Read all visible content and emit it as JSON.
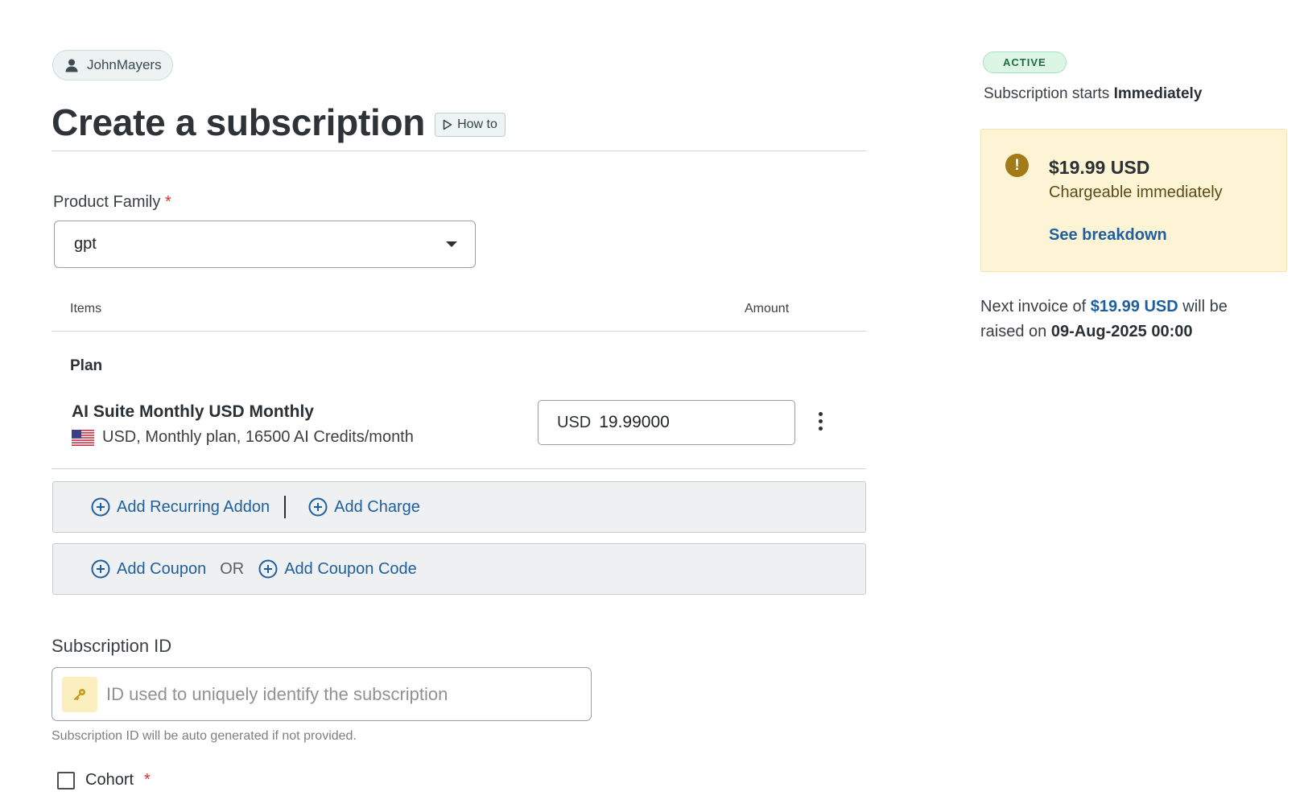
{
  "user": {
    "name": "JohnMayers"
  },
  "page": {
    "title": "Create a subscription",
    "how_to_label": "How to"
  },
  "product_family": {
    "label": "Product Family",
    "required_mark": "*",
    "value": "gpt"
  },
  "items_table": {
    "col_items": "Items",
    "col_amount": "Amount",
    "section_label": "Plan",
    "plan": {
      "name": "AI Suite Monthly USD Monthly",
      "details": "USD, Monthly plan, 16500 AI Credits/month",
      "currency": "USD",
      "amount": "19.99000"
    }
  },
  "actions": {
    "add_recurring_addon": "Add Recurring Addon",
    "add_charge": "Add Charge",
    "add_coupon": "Add Coupon",
    "or_text": "OR",
    "add_coupon_code": "Add Coupon Code"
  },
  "subscription_id": {
    "label": "Subscription ID",
    "placeholder": "ID used to uniquely identify the subscription",
    "value": "",
    "hint": "Subscription ID will be auto generated if not provided."
  },
  "cohort": {
    "label": "Cohort",
    "required_mark": "*",
    "checked": false
  },
  "summary": {
    "status": "ACTIVE",
    "starts_prefix": "Subscription starts",
    "starts_value": "Immediately",
    "charge_amount": "$19.99 USD",
    "charge_note": "Chargeable immediately",
    "breakdown_link": "See breakdown",
    "next_invoice_prefix": "Next invoice of",
    "next_invoice_amount": "$19.99 USD",
    "next_invoice_middle": "will be raised on",
    "next_invoice_date": "09-Aug-2025 00:00"
  },
  "colors": {
    "link": "#1f5f9e",
    "warning_bg": "#fdf4d6",
    "active_badge": "#dcf5e4",
    "required": "#d0312d"
  },
  "icons": [
    "user-icon",
    "play-icon",
    "chevron-down-icon",
    "us-flag-icon",
    "kebab-menu-icon",
    "plus-circle-icon",
    "key-icon",
    "exclamation-icon"
  ]
}
